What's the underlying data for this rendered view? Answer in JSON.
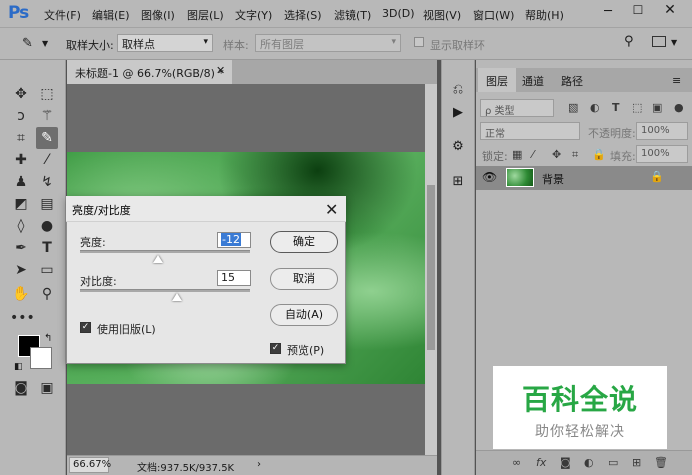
{
  "app": {
    "logo": "Ps"
  },
  "menu": [
    "文件(F)",
    "编辑(E)",
    "图像(I)",
    "图层(L)",
    "文字(Y)",
    "选择(S)",
    "滤镜(T)",
    "3D(D)",
    "视图(V)",
    "窗口(W)",
    "帮助(H)"
  ],
  "window_controls": {
    "minimize": "─",
    "maximize": "☐",
    "close": "✕"
  },
  "options_bar": {
    "sample_size_label": "取样大小:",
    "sample_size_value": "取样点",
    "sample_label": "样本:",
    "sample_value": "所有图层",
    "show_ring_label": "显示取样环"
  },
  "document": {
    "tab_title": "未标题-1 @ 66.7%(RGB/8) *",
    "zoom": "66.67%",
    "doc_info": "文档:937.5K/937.5K"
  },
  "layers_panel": {
    "tabs": [
      "图层",
      "通道",
      "路径"
    ],
    "kind_label": "ρ 类型",
    "blend_mode": "正常",
    "opacity_label": "不透明度:",
    "opacity_value": "100%",
    "lock_label": "锁定:",
    "fill_label": "填充:",
    "fill_value": "100%",
    "layer_name": "背景"
  },
  "dialog": {
    "title": "亮度/对比度",
    "brightness_label": "亮度:",
    "brightness_value": "-12",
    "brightness_level": 0.46,
    "contrast_label": "对比度:",
    "contrast_value": "15",
    "contrast_level": 0.57,
    "legacy_label": "使用旧版(L)",
    "legacy_checked": true,
    "ok_label": "确定",
    "cancel_label": "取消",
    "auto_label": "自动(A)",
    "preview_label": "预览(P)",
    "preview_checked": true
  },
  "watermark": {
    "title": "百科全说",
    "subtitle": "助你轻松解决"
  },
  "colors": {
    "accent_green": "#28a745",
    "selection_blue": "#3a7bd5",
    "ps_blue": "#2b6bc7"
  }
}
